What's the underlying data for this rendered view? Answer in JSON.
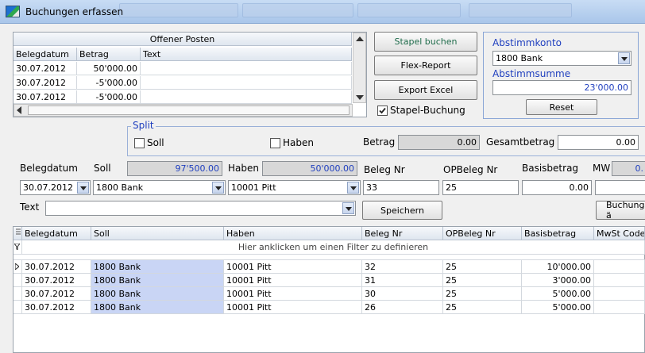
{
  "window": {
    "title": "Buchungen erfassen"
  },
  "open_items": {
    "title": "Offener Posten",
    "columns": [
      "Belegdatum",
      "Betrag",
      "Text"
    ],
    "rows": [
      {
        "date": "30.07.2012",
        "amount": "50'000.00",
        "text": ""
      },
      {
        "date": "30.07.2012",
        "amount": "-5'000.00",
        "text": ""
      },
      {
        "date": "30.07.2012",
        "amount": "-5'000.00",
        "text": ""
      }
    ]
  },
  "actions": {
    "stapel_buchen": "Stapel buchen",
    "flex_report": "Flex-Report",
    "export_excel": "Export Excel",
    "stapel_buchung_label": "Stapel-Buchung",
    "stapel_buchung_checked": true
  },
  "reconcile": {
    "account_label": "Abstimmkonto",
    "account_value": "1800 Bank",
    "sum_label": "Abstimmsumme",
    "sum_value": "23'000.00",
    "reset": "Reset"
  },
  "split": {
    "title": "Split",
    "soll_label": "Soll",
    "haben_label": "Haben",
    "betrag_label": "Betrag",
    "betrag_value": "0.00",
    "gesamt_label": "Gesamtbetrag",
    "gesamt_value": "0.00"
  },
  "form": {
    "belegdatum_label": "Belegdatum",
    "soll_label": "Soll",
    "soll_total": "97'500.00",
    "haben_label": "Haben",
    "haben_total": "50'000.00",
    "belegnr_label": "Beleg Nr",
    "opbelegnr_label": "OPBeleg Nr",
    "basisbetrag_label": "Basisbetrag",
    "mw_label": "MW",
    "mw_value": "0.",
    "belegdatum_value": "30.07.2012",
    "soll_value": "1800 Bank",
    "haben_value": "10001 Pitt",
    "belegnr_value": "33",
    "opbelegnr_value": "25",
    "basisbetrag_value": "0.00",
    "text_label": "Text",
    "text_value": "",
    "save": "Speichern",
    "buchung": "Buchung ä"
  },
  "grid": {
    "columns": [
      "Belegdatum",
      "Soll",
      "Haben",
      "Beleg Nr",
      "OPBeleg Nr",
      "Basisbetrag",
      "MwSt Code"
    ],
    "filter_hint": "Hier anklicken um einen Filter zu definieren",
    "rows": [
      {
        "date": "30.07.2012",
        "soll": "1800 Bank",
        "haben": "10001 Pitt",
        "belegnr": "32",
        "opbelegnr": "25",
        "basis": "10'000.00",
        "mwst": ""
      },
      {
        "date": "30.07.2012",
        "soll": "1800 Bank",
        "haben": "10001 Pitt",
        "belegnr": "31",
        "opbelegnr": "25",
        "basis": "3'000.00",
        "mwst": ""
      },
      {
        "date": "30.07.2012",
        "soll": "1800 Bank",
        "haben": "10001 Pitt",
        "belegnr": "30",
        "opbelegnr": "25",
        "basis": "5'000.00",
        "mwst": ""
      },
      {
        "date": "30.07.2012",
        "soll": "1800 Bank",
        "haben": "10001 Pitt",
        "belegnr": "26",
        "opbelegnr": "25",
        "basis": "5'000.00",
        "mwst": ""
      }
    ]
  },
  "colors": {
    "accent_blue": "#1f3fbf",
    "selected_cell": "#c9d5f5",
    "stapel_text": "#1e6b4a"
  }
}
